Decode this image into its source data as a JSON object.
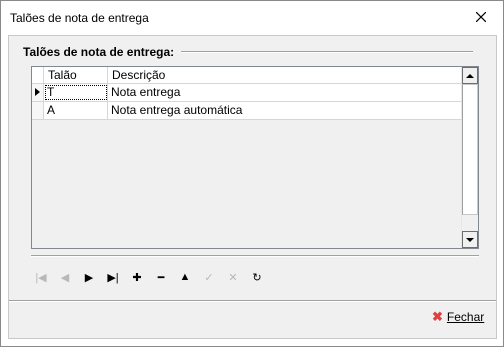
{
  "window": {
    "title": "Talões de nota de entrega",
    "close_icon": "close-icon"
  },
  "group": {
    "title": "Talões de nota de entrega:"
  },
  "grid": {
    "columns": [
      "Talão",
      "Descrição"
    ],
    "rows": [
      {
        "talao": "T",
        "descricao": "Nota entrega",
        "current": true
      },
      {
        "talao": "A",
        "descricao": "Nota entrega automática",
        "current": false
      }
    ]
  },
  "navigator": {
    "buttons": [
      {
        "name": "first-record-icon",
        "glyph": "|◀",
        "enabled": false
      },
      {
        "name": "prior-record-icon",
        "glyph": "◀",
        "enabled": false
      },
      {
        "name": "next-record-icon",
        "glyph": "▶",
        "enabled": true
      },
      {
        "name": "last-record-icon",
        "glyph": "▶|",
        "enabled": true
      },
      {
        "name": "insert-record-icon",
        "glyph": "✚",
        "enabled": true
      },
      {
        "name": "delete-record-icon",
        "glyph": "━",
        "enabled": true
      },
      {
        "name": "edit-record-icon",
        "glyph": "▲",
        "enabled": true
      },
      {
        "name": "post-record-icon",
        "glyph": "✓",
        "enabled": false
      },
      {
        "name": "cancel-record-icon",
        "glyph": "✕",
        "enabled": false
      },
      {
        "name": "refresh-icon",
        "glyph": "↻",
        "enabled": true
      }
    ]
  },
  "footer": {
    "close_label": "Fechar",
    "close_icon": "x-icon",
    "accent_color": "#e04040"
  }
}
